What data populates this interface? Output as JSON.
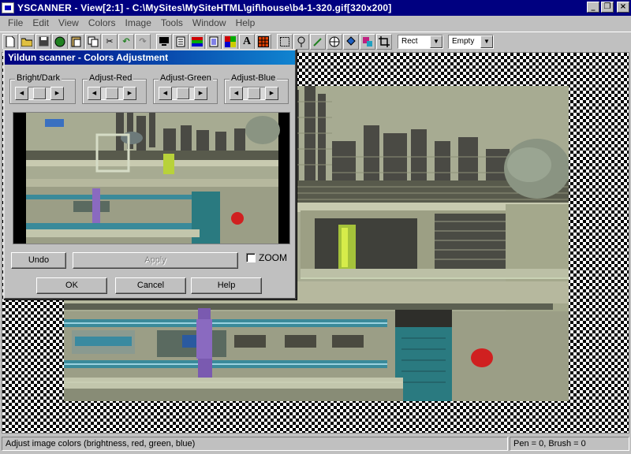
{
  "app": {
    "title": "YSCANNER - View[2:1] - C:\\MySites\\MySiteHTML\\gif\\house\\b4-1-320.gif[320x200]",
    "window_buttons": {
      "minimize": "_",
      "restore": "❐",
      "close": "×"
    }
  },
  "menubar": {
    "items": [
      "File",
      "Edit",
      "View",
      "Colors",
      "Image",
      "Tools",
      "Window",
      "Help"
    ]
  },
  "toolbar": {
    "icons": [
      "new-file-icon",
      "open-folder-icon",
      "save-icon",
      "scan-icon",
      "paste-icon",
      "copy-icon",
      "cut-icon",
      "undo-icon",
      "redo-icon",
      "monitor-icon",
      "page-icon",
      "palette-icon",
      "list-icon",
      "colors-icon",
      "text-icon",
      "grid-icon",
      "select-icon",
      "dropper-icon",
      "pencil-icon",
      "fill-icon",
      "bucket-icon",
      "brush-icon",
      "crop-icon"
    ],
    "shape_select": "Rect",
    "fill_select": "Empty"
  },
  "dialog": {
    "title": "Yildun scanner - Colors Adjustment",
    "groups": [
      "Bright/Dark",
      "Adjust-Red",
      "Adjust-Green",
      "Adjust-Blue"
    ],
    "undo_label": "Undo",
    "apply_label": "Apply",
    "zoom_label": "ZOOM",
    "ok_label": "OK",
    "cancel_label": "Cancel",
    "help_label": "Help"
  },
  "status": {
    "message": "Adjust image colors (brightness, red, green, blue)",
    "pen_brush": "Pen = 0,  Brush = 0"
  },
  "colors": {
    "title_bar": "#000080",
    "dialog_title_start": "#000080",
    "dialog_title_end": "#1084d0",
    "face": "#c0c0c0"
  }
}
